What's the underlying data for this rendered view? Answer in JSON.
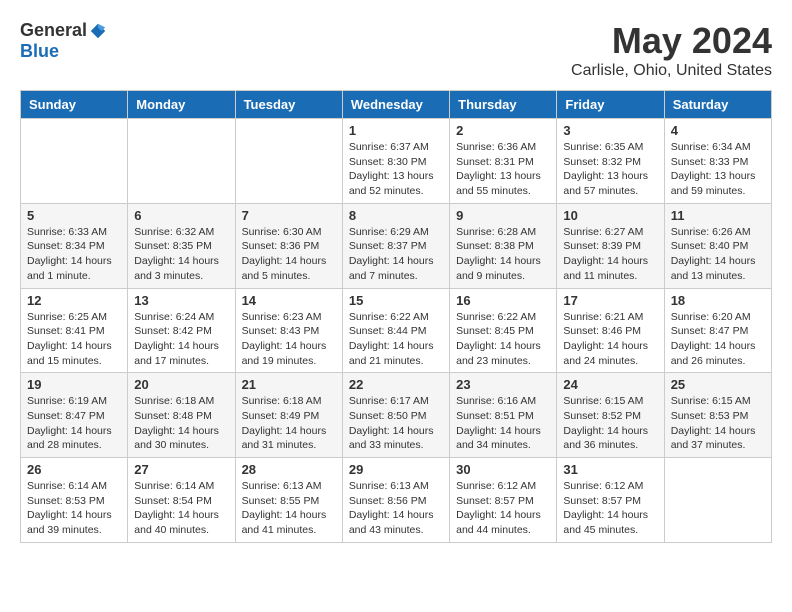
{
  "header": {
    "logo_general": "General",
    "logo_blue": "Blue",
    "month_title": "May 2024",
    "location": "Carlisle, Ohio, United States"
  },
  "days_of_week": [
    "Sunday",
    "Monday",
    "Tuesday",
    "Wednesday",
    "Thursday",
    "Friday",
    "Saturday"
  ],
  "weeks": [
    [
      {
        "day": "",
        "info": ""
      },
      {
        "day": "",
        "info": ""
      },
      {
        "day": "",
        "info": ""
      },
      {
        "day": "1",
        "info": "Sunrise: 6:37 AM\nSunset: 8:30 PM\nDaylight: 13 hours\nand 52 minutes."
      },
      {
        "day": "2",
        "info": "Sunrise: 6:36 AM\nSunset: 8:31 PM\nDaylight: 13 hours\nand 55 minutes."
      },
      {
        "day": "3",
        "info": "Sunrise: 6:35 AM\nSunset: 8:32 PM\nDaylight: 13 hours\nand 57 minutes."
      },
      {
        "day": "4",
        "info": "Sunrise: 6:34 AM\nSunset: 8:33 PM\nDaylight: 13 hours\nand 59 minutes."
      }
    ],
    [
      {
        "day": "5",
        "info": "Sunrise: 6:33 AM\nSunset: 8:34 PM\nDaylight: 14 hours\nand 1 minute."
      },
      {
        "day": "6",
        "info": "Sunrise: 6:32 AM\nSunset: 8:35 PM\nDaylight: 14 hours\nand 3 minutes."
      },
      {
        "day": "7",
        "info": "Sunrise: 6:30 AM\nSunset: 8:36 PM\nDaylight: 14 hours\nand 5 minutes."
      },
      {
        "day": "8",
        "info": "Sunrise: 6:29 AM\nSunset: 8:37 PM\nDaylight: 14 hours\nand 7 minutes."
      },
      {
        "day": "9",
        "info": "Sunrise: 6:28 AM\nSunset: 8:38 PM\nDaylight: 14 hours\nand 9 minutes."
      },
      {
        "day": "10",
        "info": "Sunrise: 6:27 AM\nSunset: 8:39 PM\nDaylight: 14 hours\nand 11 minutes."
      },
      {
        "day": "11",
        "info": "Sunrise: 6:26 AM\nSunset: 8:40 PM\nDaylight: 14 hours\nand 13 minutes."
      }
    ],
    [
      {
        "day": "12",
        "info": "Sunrise: 6:25 AM\nSunset: 8:41 PM\nDaylight: 14 hours\nand 15 minutes."
      },
      {
        "day": "13",
        "info": "Sunrise: 6:24 AM\nSunset: 8:42 PM\nDaylight: 14 hours\nand 17 minutes."
      },
      {
        "day": "14",
        "info": "Sunrise: 6:23 AM\nSunset: 8:43 PM\nDaylight: 14 hours\nand 19 minutes."
      },
      {
        "day": "15",
        "info": "Sunrise: 6:22 AM\nSunset: 8:44 PM\nDaylight: 14 hours\nand 21 minutes."
      },
      {
        "day": "16",
        "info": "Sunrise: 6:22 AM\nSunset: 8:45 PM\nDaylight: 14 hours\nand 23 minutes."
      },
      {
        "day": "17",
        "info": "Sunrise: 6:21 AM\nSunset: 8:46 PM\nDaylight: 14 hours\nand 24 minutes."
      },
      {
        "day": "18",
        "info": "Sunrise: 6:20 AM\nSunset: 8:47 PM\nDaylight: 14 hours\nand 26 minutes."
      }
    ],
    [
      {
        "day": "19",
        "info": "Sunrise: 6:19 AM\nSunset: 8:47 PM\nDaylight: 14 hours\nand 28 minutes."
      },
      {
        "day": "20",
        "info": "Sunrise: 6:18 AM\nSunset: 8:48 PM\nDaylight: 14 hours\nand 30 minutes."
      },
      {
        "day": "21",
        "info": "Sunrise: 6:18 AM\nSunset: 8:49 PM\nDaylight: 14 hours\nand 31 minutes."
      },
      {
        "day": "22",
        "info": "Sunrise: 6:17 AM\nSunset: 8:50 PM\nDaylight: 14 hours\nand 33 minutes."
      },
      {
        "day": "23",
        "info": "Sunrise: 6:16 AM\nSunset: 8:51 PM\nDaylight: 14 hours\nand 34 minutes."
      },
      {
        "day": "24",
        "info": "Sunrise: 6:15 AM\nSunset: 8:52 PM\nDaylight: 14 hours\nand 36 minutes."
      },
      {
        "day": "25",
        "info": "Sunrise: 6:15 AM\nSunset: 8:53 PM\nDaylight: 14 hours\nand 37 minutes."
      }
    ],
    [
      {
        "day": "26",
        "info": "Sunrise: 6:14 AM\nSunset: 8:53 PM\nDaylight: 14 hours\nand 39 minutes."
      },
      {
        "day": "27",
        "info": "Sunrise: 6:14 AM\nSunset: 8:54 PM\nDaylight: 14 hours\nand 40 minutes."
      },
      {
        "day": "28",
        "info": "Sunrise: 6:13 AM\nSunset: 8:55 PM\nDaylight: 14 hours\nand 41 minutes."
      },
      {
        "day": "29",
        "info": "Sunrise: 6:13 AM\nSunset: 8:56 PM\nDaylight: 14 hours\nand 43 minutes."
      },
      {
        "day": "30",
        "info": "Sunrise: 6:12 AM\nSunset: 8:57 PM\nDaylight: 14 hours\nand 44 minutes."
      },
      {
        "day": "31",
        "info": "Sunrise: 6:12 AM\nSunset: 8:57 PM\nDaylight: 14 hours\nand 45 minutes."
      },
      {
        "day": "",
        "info": ""
      }
    ]
  ]
}
